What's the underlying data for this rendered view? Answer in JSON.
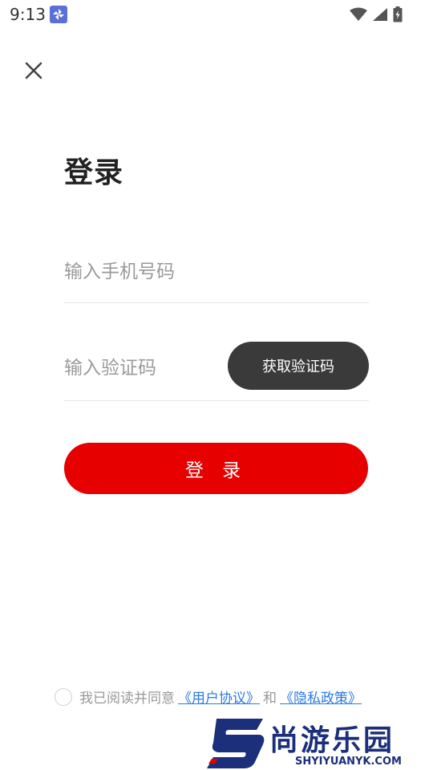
{
  "status_bar": {
    "time": "9:13",
    "app_icon": "pinwheel-icon",
    "icons": [
      "wifi-icon",
      "signal-icon",
      "battery-icon"
    ]
  },
  "header": {
    "close_icon": "close-icon"
  },
  "title": "登录",
  "phone": {
    "placeholder": "输入手机号码",
    "value": ""
  },
  "code": {
    "placeholder": "输入验证码",
    "value": "",
    "button_label": "获取验证码"
  },
  "login_button": "登 录",
  "agreement": {
    "checked": false,
    "prefix": "我已阅读并同意",
    "user_agreement": "《用户协议》",
    "conjunction": "和",
    "privacy_policy": "《隐私政策》"
  },
  "watermark": {
    "name": "尚游乐园",
    "domain": "SHYIYUANYK.COM"
  },
  "colors": {
    "primary": "#e60000",
    "dark_button": "#3a3a3a",
    "link": "#2a7ae2",
    "watermark": "#1b2f7a"
  }
}
